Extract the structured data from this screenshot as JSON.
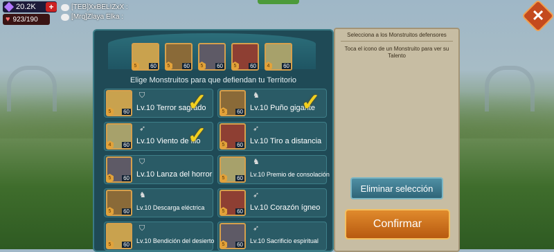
{
  "hud": {
    "gems": "20.2K",
    "stamina": "923/190",
    "plus_label": "+"
  },
  "chat": [
    {
      "text": "[TEB]XxBELIZxX :"
    },
    {
      "text": "[Mrq]Zlaya Elka :"
    }
  ],
  "close_label": "✕",
  "defenders": [
    {
      "level": "60",
      "stars": "5",
      "icon": "monster-portrait-icon"
    },
    {
      "level": "60",
      "stars": "5",
      "icon": "monster-portrait-icon"
    },
    {
      "level": "60",
      "stars": "5",
      "icon": "monster-portrait-icon"
    },
    {
      "level": "60",
      "stars": "5",
      "icon": "monster-portrait-icon"
    },
    {
      "level": "60",
      "stars": "4",
      "icon": "monster-portrait-icon"
    }
  ],
  "subtitle": "Elige Monstruitos para que defiendan tu Territorio",
  "monsters": [
    {
      "name": "Lv.10 Terror sagrado",
      "level": "60",
      "stars": "5",
      "class_icon": "shield-icon",
      "selected": true
    },
    {
      "name": "Lv.10 Puño gigante",
      "level": "60",
      "stars": "5",
      "class_icon": "horse-icon",
      "selected": true
    },
    {
      "name": "Lv.10 Viento de filo",
      "level": "60",
      "stars": "4",
      "class_icon": "bow-icon",
      "selected": true
    },
    {
      "name": "Lv.10 Tiro a distancia",
      "level": "60",
      "stars": "5",
      "class_icon": "bow-icon",
      "selected": false
    },
    {
      "name": "Lv.10 Lanza del horror",
      "level": "60",
      "stars": "5",
      "class_icon": "shield-icon",
      "selected": false
    },
    {
      "name": "Lv.10 Premio de consolación",
      "level": "60",
      "stars": "5",
      "class_icon": "horse-icon",
      "selected": false
    },
    {
      "name": "Lv.10 Descarga eléctrica",
      "level": "60",
      "stars": "5",
      "class_icon": "horse-icon",
      "selected": false
    },
    {
      "name": "Lv.10 Corazón ígneo",
      "level": "60",
      "stars": "5",
      "class_icon": "bow-icon",
      "selected": false
    },
    {
      "name": "Lv.10 Bendición del desierto",
      "level": "60",
      "stars": "5",
      "class_icon": "shield-icon",
      "selected": false
    },
    {
      "name": "Lv.10 Sacrificio espiritual",
      "level": "60",
      "stars": "5",
      "class_icon": "bow-icon",
      "selected": false
    }
  ],
  "info": {
    "title": "Selecciona a los Monstruitos defensores",
    "hint": "Toca el icono de un Monstruito para ver su Talento",
    "clear_label": "Eliminar selección",
    "confirm_label": "Confirmar"
  },
  "colors": {
    "panel": "#1f4a56",
    "check": "#f2cf1f",
    "confirm": "#e08a2c",
    "clear": "#4f8fa4"
  }
}
